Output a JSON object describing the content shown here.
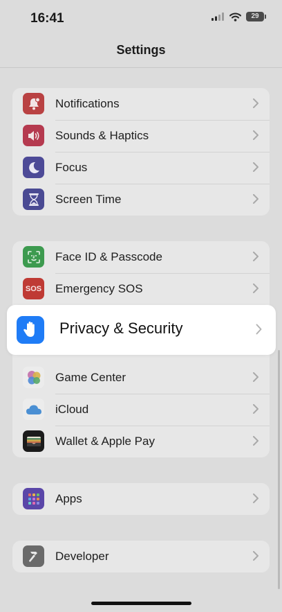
{
  "status_bar": {
    "time": "16:41",
    "battery": "29"
  },
  "nav": {
    "title": "Settings"
  },
  "groups": [
    {
      "items": [
        {
          "label": "Notifications",
          "icon": "bell-badge-icon",
          "color": "#b94243"
        },
        {
          "label": "Sounds & Haptics",
          "icon": "speaker-icon",
          "color": "#b53a4f"
        },
        {
          "label": "Focus",
          "icon": "moon-icon",
          "color": "#4d4a97"
        },
        {
          "label": "Screen Time",
          "icon": "hourglass-icon",
          "color": "#4a4a93"
        }
      ]
    },
    {
      "items": [
        {
          "label": "Face ID & Passcode",
          "icon": "face-id-icon",
          "color": "#3d9a4f"
        },
        {
          "label": "Emergency SOS",
          "icon": "sos-icon",
          "color": "#bf3a34"
        }
      ]
    },
    {
      "items": [
        {
          "label": "Game Center",
          "icon": "game-center-icon"
        },
        {
          "label": "iCloud",
          "icon": "cloud-icon",
          "color": "#4a8fd3"
        },
        {
          "label": "Wallet & Apple Pay",
          "icon": "wallet-icon",
          "color": "#1b1b1b"
        }
      ]
    },
    {
      "items": [
        {
          "label": "Apps",
          "icon": "apps-grid-icon",
          "color": "#5a46a8"
        }
      ]
    },
    {
      "items": [
        {
          "label": "Developer",
          "icon": "hammer-icon",
          "color": "#6a6a6a"
        }
      ]
    }
  ],
  "highlighted": {
    "label": "Privacy & Security",
    "icon": "hand-icon",
    "color": "#1f7cf6"
  }
}
